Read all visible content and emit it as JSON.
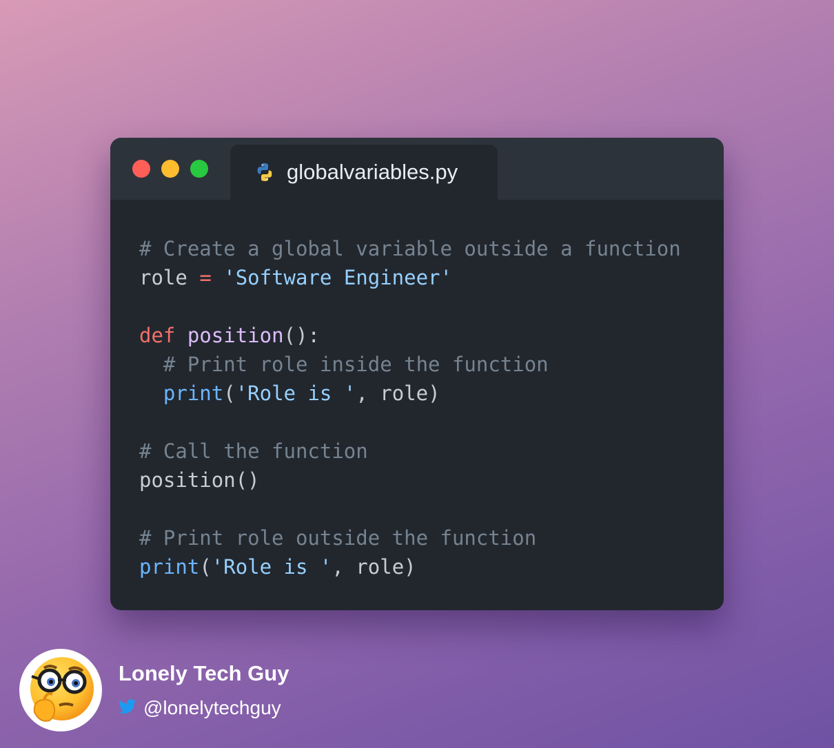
{
  "window": {
    "tab_label": "globalvariables.py",
    "tab_icon": "python-icon",
    "controls": [
      "close-dot",
      "minimize-dot",
      "maximize-dot"
    ]
  },
  "code": {
    "lines": [
      [
        {
          "t": "# Create a global variable outside a function",
          "k": "comment"
        }
      ],
      [
        {
          "t": "role ",
          "k": "plain"
        },
        {
          "t": "=",
          "k": "operator"
        },
        {
          "t": " ",
          "k": "plain"
        },
        {
          "t": "'Software Engineer'",
          "k": "string"
        }
      ],
      [],
      [
        {
          "t": "def",
          "k": "keyword"
        },
        {
          "t": " ",
          "k": "plain"
        },
        {
          "t": "position",
          "k": "function"
        },
        {
          "t": "():",
          "k": "plain"
        }
      ],
      [
        {
          "t": "  ",
          "k": "plain"
        },
        {
          "t": "# Print role inside the function",
          "k": "comment"
        }
      ],
      [
        {
          "t": "  ",
          "k": "plain"
        },
        {
          "t": "print",
          "k": "builtin"
        },
        {
          "t": "(",
          "k": "plain"
        },
        {
          "t": "'Role is '",
          "k": "string"
        },
        {
          "t": ", role)",
          "k": "plain"
        }
      ],
      [],
      [
        {
          "t": "# Call the function",
          "k": "comment"
        }
      ],
      [
        {
          "t": "position()",
          "k": "plain"
        }
      ],
      [],
      [
        {
          "t": "# Print role outside the function",
          "k": "comment"
        }
      ],
      [
        {
          "t": "print",
          "k": "builtin"
        },
        {
          "t": "(",
          "k": "plain"
        },
        {
          "t": "'Role is '",
          "k": "string"
        },
        {
          "t": ", role)",
          "k": "plain"
        }
      ]
    ]
  },
  "author": {
    "name": "Lonely Tech Guy",
    "handle": "@lonelytechguy",
    "avatar_icon": "thinking-nerd-emoji-icon",
    "social_icon": "twitter-icon"
  },
  "colors": {
    "window_bg": "#22272e",
    "titlebar_bg": "#2d333b",
    "comment": "#768390",
    "keyword": "#f47067",
    "string": "#96d0ff",
    "builtin": "#6cb6ff",
    "function": "#dcbdfb"
  }
}
